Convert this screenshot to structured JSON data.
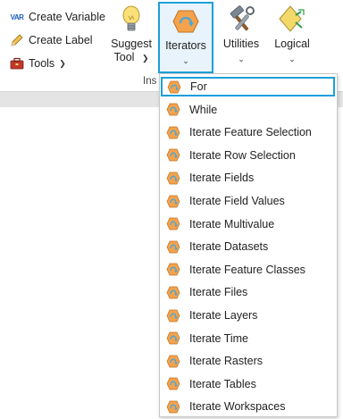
{
  "ribbon": {
    "create_variable": {
      "label": "Create Variable",
      "badge": "VAR",
      "icon": "variable-icon"
    },
    "create_label": {
      "label": "Create Label",
      "icon": "label-pencil-icon"
    },
    "tools": {
      "label": "Tools",
      "icon": "toolbox-icon"
    },
    "suggest_tool": {
      "line1": "Suggest",
      "line2": "Tool",
      "icon": "lightbulb-icon"
    },
    "iterators": {
      "label": "Iterators",
      "icon": "iterator-icon"
    },
    "utilities": {
      "label": "Utilities",
      "icon": "hammer-wrench-icon"
    },
    "logical": {
      "label": "Logical",
      "icon": "logical-diamond-icon"
    },
    "group_label": "Ins"
  },
  "iterators_menu": {
    "items": [
      {
        "label": "For"
      },
      {
        "label": "While"
      },
      {
        "label": "Iterate Feature Selection"
      },
      {
        "label": "Iterate Row Selection"
      },
      {
        "label": "Iterate Fields"
      },
      {
        "label": "Iterate Field Values"
      },
      {
        "label": "Iterate Multivalue"
      },
      {
        "label": "Iterate Datasets"
      },
      {
        "label": "Iterate Feature Classes"
      },
      {
        "label": "Iterate Files"
      },
      {
        "label": "Iterate Layers"
      },
      {
        "label": "Iterate Time"
      },
      {
        "label": "Iterate Rasters"
      },
      {
        "label": "Iterate Tables"
      },
      {
        "label": "Iterate Workspaces"
      }
    ],
    "selected_index": 0,
    "item_icon": "iterator-hexagon-icon"
  },
  "colors": {
    "accent": "#1e9fd9",
    "iterator_orange": "#f4a24c",
    "iterator_blue": "#4aa8d8"
  }
}
